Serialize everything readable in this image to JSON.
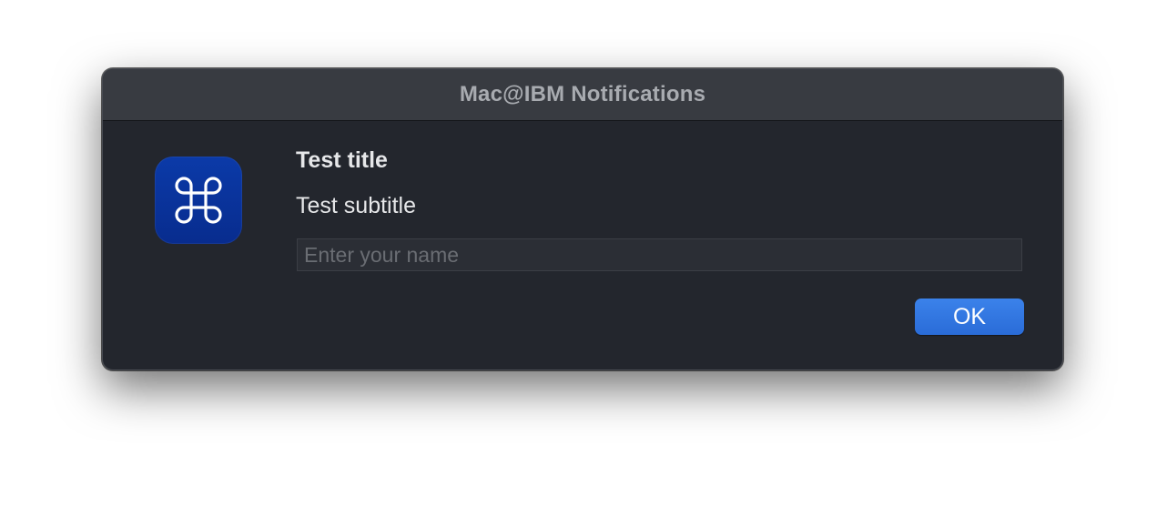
{
  "window": {
    "title": "Mac@IBM Notifications"
  },
  "app_icon": {
    "icon": "command-key-icon",
    "background_color": "#0a35a0"
  },
  "content": {
    "title": "Test title",
    "subtitle": "Test subtitle"
  },
  "name_field": {
    "value": "",
    "placeholder": "Enter your name"
  },
  "buttons": {
    "ok_label": "OK",
    "ok_color": "#2f74e0"
  }
}
